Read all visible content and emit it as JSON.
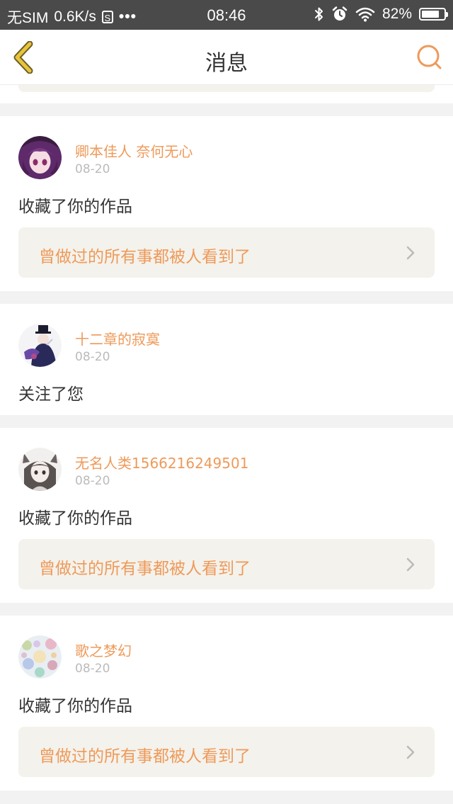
{
  "status_bar": {
    "carrier": "无SIM",
    "speed": "0.6K/s",
    "sim_icon_label": "S",
    "dots": "•••",
    "time": "08:46",
    "battery_pct": "82%",
    "battery_level": 0.82,
    "icons": [
      "bluetooth-icon",
      "alarm-icon",
      "wifi-icon",
      "battery-icon"
    ]
  },
  "nav": {
    "title": "消息",
    "back_icon": "chevron-left-icon",
    "search_icon": "search-icon",
    "accent": "#ee9a5a",
    "back_color": "#e8c43a"
  },
  "notifications": [
    {
      "user": "卿本佳人 奈何无心",
      "date": "08-20",
      "action": "收藏了你的作品",
      "work_title": "曾做过的所有事都被人看到了"
    },
    {
      "user": "十二章的寂寞",
      "date": "08-20",
      "action": "关注了您"
    },
    {
      "user": "无名人类1566216249501",
      "date": "08-20",
      "action": "收藏了你的作品",
      "work_title": "曾做过的所有事都被人看到了"
    },
    {
      "user": "歌之梦幻",
      "date": "08-20",
      "action": "收藏了你的作品",
      "work_title": "曾做过的所有事都被人看到了"
    }
  ]
}
